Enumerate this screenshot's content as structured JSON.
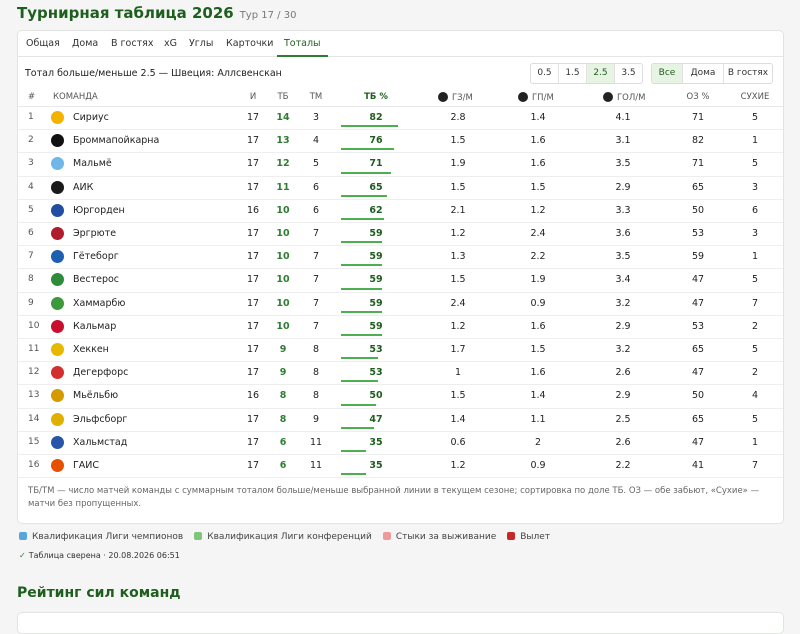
{
  "header": {
    "title": "Турнирная таблица 2026",
    "round": "Тур 17 / 30"
  },
  "tabs": [
    {
      "label": "Общая"
    },
    {
      "label": "Дома"
    },
    {
      "label": "В гостях"
    },
    {
      "label": "xG"
    },
    {
      "label": "Углы"
    },
    {
      "label": "Карточки"
    },
    {
      "label": "Тоталы",
      "active": true
    }
  ],
  "subtitle": "Тотал больше/меньше 2.5 — Швеция: Аллсвенскан",
  "lines": [
    {
      "label": "0.5"
    },
    {
      "label": "1.5"
    },
    {
      "label": "2.5",
      "selected": true
    },
    {
      "label": "3.5"
    }
  ],
  "venue": [
    {
      "label": "Все",
      "selected": true
    },
    {
      "label": "Дома"
    },
    {
      "label": "В гостях"
    }
  ],
  "columns": {
    "num": "#",
    "team": "КОМАНДА",
    "gp": "И",
    "tb": "ТБ",
    "tm": "ТМ",
    "pct": "ТБ %",
    "gz": "ГЗ/М",
    "gp2": "ГП/М",
    "gol": "ГОЛ/М",
    "oz": "ОЗ %",
    "dry": "СУХИЕ"
  },
  "rows": [
    {
      "num": "1",
      "team": "Сириус",
      "gp": "17",
      "tb": "14",
      "tm": "3",
      "pct": "82",
      "gz": "2.8",
      "gp2": "1.4",
      "gol": "4.1",
      "oz": "71",
      "dry": "5",
      "logo": "#f2b200",
      "zone": "#58a6e0"
    },
    {
      "num": "2",
      "team": "Броммапойкарна",
      "gp": "17",
      "tb": "13",
      "tm": "4",
      "pct": "76",
      "gz": "1.5",
      "gp2": "1.6",
      "gol": "3.1",
      "oz": "82",
      "dry": "1",
      "logo": "#111111",
      "zone": "#7cc57a"
    },
    {
      "num": "3",
      "team": "Мальмё",
      "gp": "17",
      "tb": "12",
      "tm": "5",
      "pct": "71",
      "gz": "1.9",
      "gp2": "1.6",
      "gol": "3.5",
      "oz": "71",
      "dry": "5",
      "logo": "#6fb7e8",
      "zone": "#7cc57a"
    },
    {
      "num": "4",
      "team": "АИК",
      "gp": "17",
      "tb": "11",
      "tm": "6",
      "pct": "65",
      "gz": "1.5",
      "gp2": "1.5",
      "gol": "2.9",
      "oz": "65",
      "dry": "3",
      "logo": "#1a1a1a",
      "zone": "#7cc57a"
    },
    {
      "num": "5",
      "team": "Юргорден",
      "gp": "16",
      "tb": "10",
      "tm": "6",
      "pct": "62",
      "gz": "2.1",
      "gp2": "1.2",
      "gol": "3.3",
      "oz": "50",
      "dry": "6",
      "logo": "#1f4ea3",
      "zone": ""
    },
    {
      "num": "6",
      "team": "Эргрюте",
      "gp": "17",
      "tb": "10",
      "tm": "7",
      "pct": "59",
      "gz": "1.2",
      "gp2": "2.4",
      "gol": "3.6",
      "oz": "53",
      "dry": "3",
      "logo": "#b01e2e",
      "zone": ""
    },
    {
      "num": "7",
      "team": "Гётеборг",
      "gp": "17",
      "tb": "10",
      "tm": "7",
      "pct": "59",
      "gz": "1.3",
      "gp2": "2.2",
      "gol": "3.5",
      "oz": "59",
      "dry": "1",
      "logo": "#1d5fb0",
      "zone": ""
    },
    {
      "num": "8",
      "team": "Вестерос",
      "gp": "17",
      "tb": "10",
      "tm": "7",
      "pct": "59",
      "gz": "1.5",
      "gp2": "1.9",
      "gol": "3.4",
      "oz": "47",
      "dry": "5",
      "logo": "#2e8b3a",
      "zone": ""
    },
    {
      "num": "9",
      "team": "Хаммарбю",
      "gp": "17",
      "tb": "10",
      "tm": "7",
      "pct": "59",
      "gz": "2.4",
      "gp2": "0.9",
      "gol": "3.2",
      "oz": "47",
      "dry": "7",
      "logo": "#3c9a3c",
      "zone": ""
    },
    {
      "num": "10",
      "team": "Кальмар",
      "gp": "17",
      "tb": "10",
      "tm": "7",
      "pct": "59",
      "gz": "1.2",
      "gp2": "1.6",
      "gol": "2.9",
      "oz": "53",
      "dry": "2",
      "logo": "#c8102e",
      "zone": ""
    },
    {
      "num": "11",
      "team": "Хеккен",
      "gp": "17",
      "tb": "9",
      "tm": "8",
      "pct": "53",
      "gz": "1.7",
      "gp2": "1.5",
      "gol": "3.2",
      "oz": "65",
      "dry": "5",
      "logo": "#e6b800",
      "zone": ""
    },
    {
      "num": "12",
      "team": "Дегерфорс",
      "gp": "17",
      "tb": "9",
      "tm": "8",
      "pct": "53",
      "gz": "1",
      "gp2": "1.6",
      "gol": "2.6",
      "oz": "47",
      "dry": "2",
      "logo": "#d32f2f",
      "zone": ""
    },
    {
      "num": "13",
      "team": "Мьёльбю",
      "gp": "16",
      "tb": "8",
      "tm": "8",
      "pct": "50",
      "gz": "1.5",
      "gp2": "1.4",
      "gol": "2.9",
      "oz": "50",
      "dry": "4",
      "logo": "#d49a00",
      "zone": ""
    },
    {
      "num": "14",
      "team": "Эльфсборг",
      "gp": "17",
      "tb": "8",
      "tm": "9",
      "pct": "47",
      "gz": "1.4",
      "gp2": "1.1",
      "gol": "2.5",
      "oz": "65",
      "dry": "5",
      "logo": "#e0b000",
      "zone": "#ef9a9a"
    },
    {
      "num": "15",
      "team": "Хальмстад",
      "gp": "17",
      "tb": "6",
      "tm": "11",
      "pct": "35",
      "gz": "0.6",
      "gp2": "2",
      "gol": "2.6",
      "oz": "47",
      "dry": "1",
      "logo": "#2756a8",
      "zone": "#c62828"
    },
    {
      "num": "16",
      "team": "ГАИС",
      "gp": "17",
      "tb": "6",
      "tm": "11",
      "pct": "35",
      "gz": "1.2",
      "gp2": "0.9",
      "gol": "2.2",
      "oz": "41",
      "dry": "7",
      "logo": "#e65100",
      "zone": "#c62828"
    }
  ],
  "footnote": "ТБ/ТМ — число матчей команды с суммарным тоталом больше/меньше выбранной линии в текущем сезоне; сортировка по доле ТБ. ОЗ — обе забьют, «Сухие» — матчи без пропущенных.",
  "legend": [
    {
      "label": "Квалификация Лиги чемпионов",
      "color": "#58a6e0"
    },
    {
      "label": "Квалификация Лиги конференций",
      "color": "#7cc57a"
    },
    {
      "label": "Стыки за выживание",
      "color": "#ef9a9a"
    },
    {
      "label": "Вылет",
      "color": "#c62828"
    }
  ],
  "verified": "Таблица сверена · 20.08.2026 06:51",
  "rating_title": "Рейтинг сил команд",
  "colors": {
    "accent": "#2e7d32",
    "title": "#1e5e1e",
    "bar": "#4caf50"
  }
}
